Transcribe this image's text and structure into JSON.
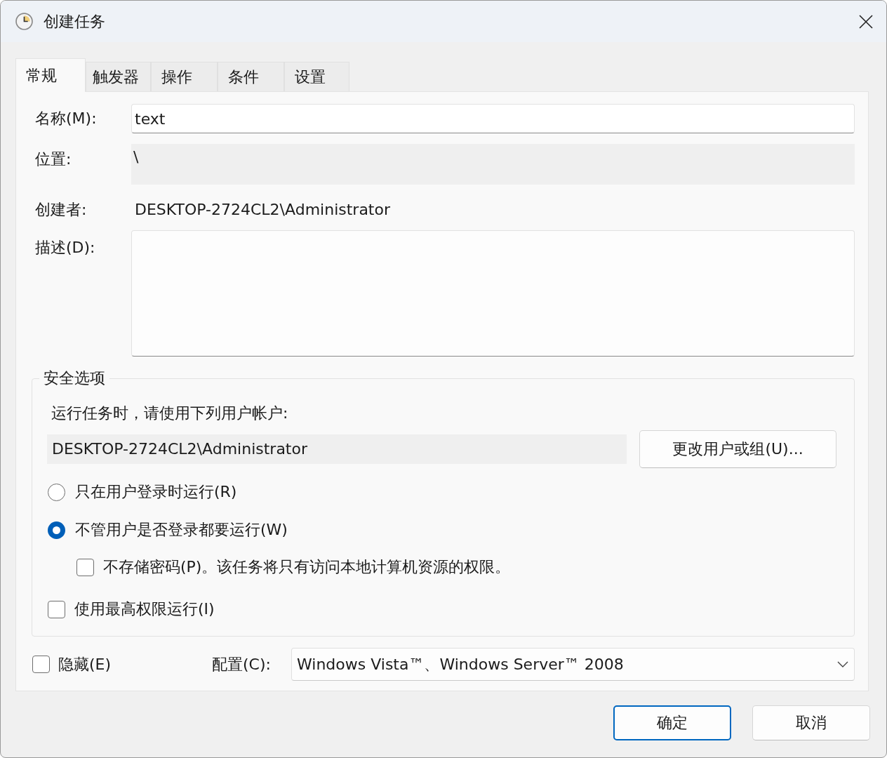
{
  "window": {
    "title": "创建任务"
  },
  "tabs": [
    {
      "label": "常规",
      "selected": true
    },
    {
      "label": "触发器",
      "selected": false
    },
    {
      "label": "操作",
      "selected": false
    },
    {
      "label": "条件",
      "selected": false
    },
    {
      "label": "设置",
      "selected": false
    }
  ],
  "general": {
    "fields": [
      {
        "kind": "input",
        "label": "名称(M):",
        "value": "text"
      },
      {
        "kind": "readonly",
        "label": "位置:",
        "value": "\\"
      },
      {
        "kind": "text",
        "label": "创建者:",
        "value": "DESKTOP-2724CL2\\Administrator"
      },
      {
        "kind": "textarea",
        "label": "描述(D):"
      }
    ],
    "security": {
      "title": "安全选项",
      "prompt": "运行任务时，请使用下列用户帐户:",
      "account": "DESKTOP-2724CL2\\Administrator",
      "change_button": "更改用户或组(U)...",
      "options": [
        {
          "kind": "radio",
          "label": "只在用户登录时运行(R)",
          "selected": false
        },
        {
          "kind": "radio",
          "label": "不管用户是否登录都要运行(W)",
          "selected": true,
          "children": [
            {
              "kind": "checkbox",
              "label": "不存储密码(P)。该任务将只有访问本地计算机资源的权限。",
              "checked": false
            }
          ]
        },
        {
          "kind": "checkbox",
          "label": "使用最高权限运行(I)",
          "checked": false
        }
      ]
    },
    "hidden": {
      "label": "隐藏(E)",
      "checked": false
    },
    "configure": {
      "label": "配置(C):",
      "value": "Windows Vista™、Windows Server™ 2008"
    }
  },
  "buttons": [
    {
      "label": "确定",
      "default": true
    },
    {
      "label": "取消",
      "default": false
    }
  ]
}
